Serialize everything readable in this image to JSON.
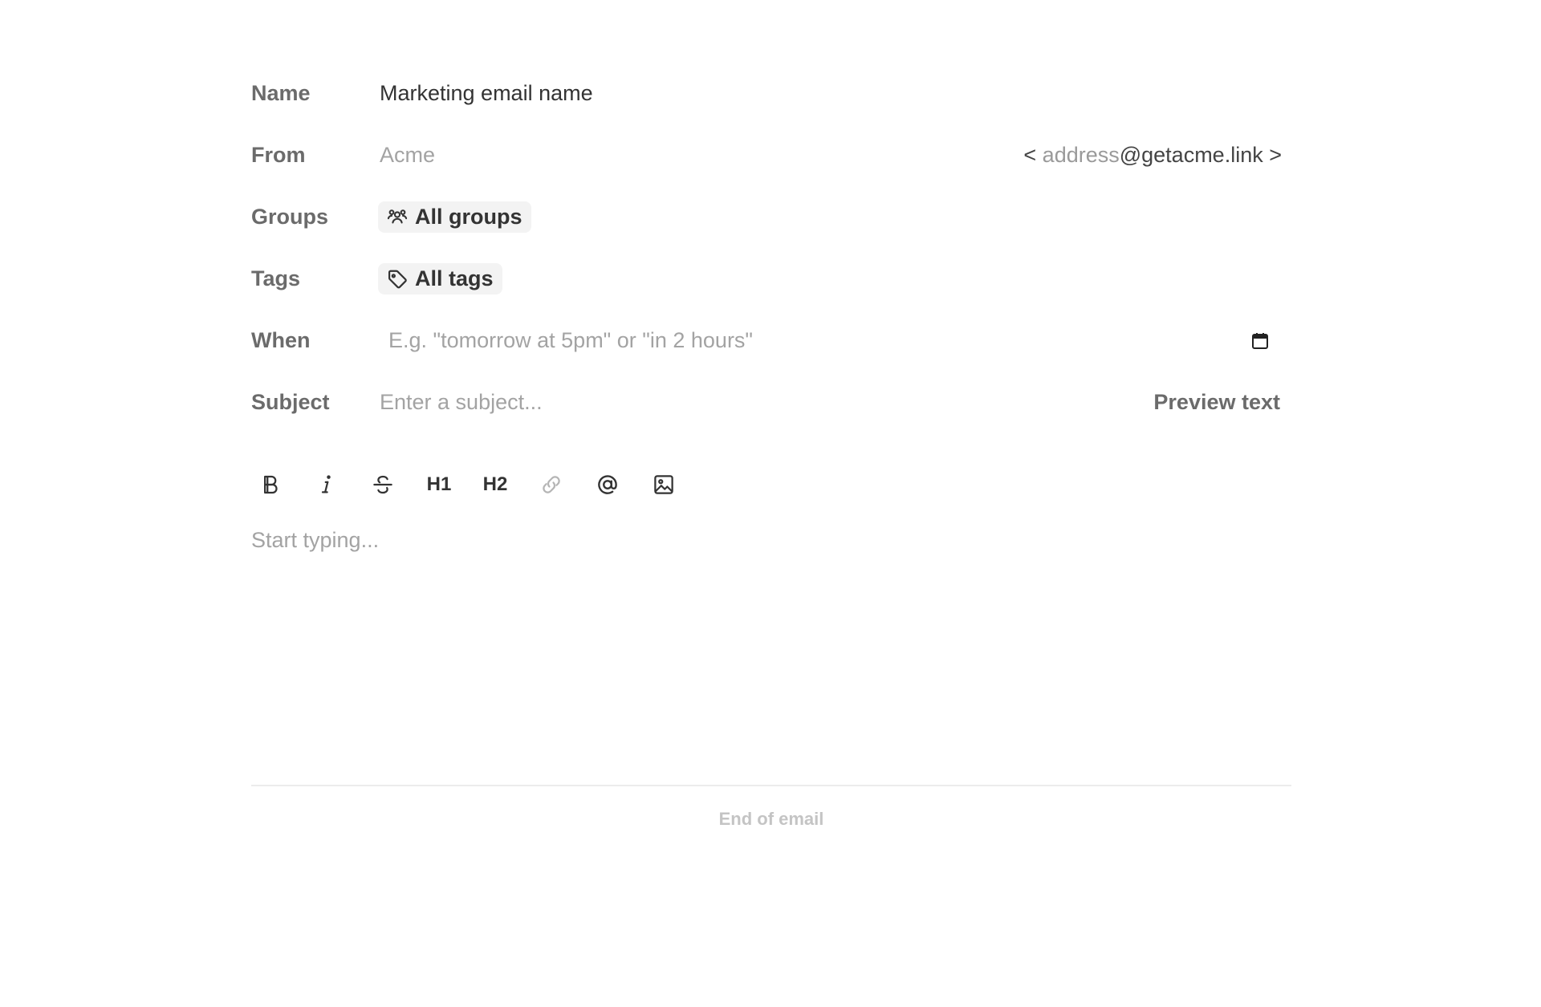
{
  "fields": {
    "name": {
      "label": "Name",
      "value": "Marketing email name"
    },
    "from": {
      "label": "From",
      "placeholder": "Acme",
      "address_open": "< ",
      "address_placeholder": "address",
      "address_domain": "@getacme.link",
      "address_close": " >"
    },
    "groups": {
      "label": "Groups",
      "chip": "All groups",
      "icon": "users-icon"
    },
    "tags": {
      "label": "Tags",
      "chip": "All tags",
      "icon": "tag-icon"
    },
    "when": {
      "label": "When",
      "placeholder": "E.g. \"tomorrow at 5pm\" or \"in 2 hours\"",
      "icon": "calendar-icon"
    },
    "subject": {
      "label": "Subject",
      "placeholder": "Enter a subject...",
      "preview_label": "Preview text"
    }
  },
  "toolbar": {
    "h1": "H1",
    "h2": "H2",
    "icons": [
      "bold-icon",
      "italic-icon",
      "strikethrough-icon",
      "link-icon",
      "mention-icon",
      "image-icon"
    ]
  },
  "editor": {
    "placeholder": "Start typing..."
  },
  "footer": {
    "end_label": "End of email"
  }
}
